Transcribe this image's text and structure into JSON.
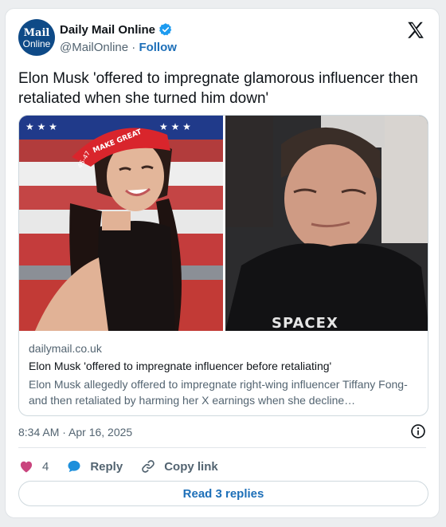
{
  "account": {
    "avatar_line1": "Mail",
    "avatar_line2": "Online",
    "name": "Daily Mail Online",
    "handle": "@MailOnline",
    "separator": "·",
    "follow_label": "Follow"
  },
  "tweet": {
    "text": "Elon Musk 'offered to impregnate glamorous influencer then retaliated when she turned him down'",
    "timestamp": "8:34 AM · Apr 16, 2025"
  },
  "link_card": {
    "domain": "dailymail.co.uk",
    "title": "Elon Musk 'offered to impregnate influencer before retaliating'",
    "description": "Elon Musk allegedly offered to impregnate right-wing influencer Tiffany Fong- and then retaliated by harming her X earnings when she decline…",
    "image_left_cap_text": "MAKE GREAT",
    "image_left_cap_number": "45-47",
    "image_right_shirt_text": "SPACEX"
  },
  "actions": {
    "like_count": "4",
    "reply_label": "Reply",
    "copy_label": "Copy link",
    "read_replies_label": "Read 3 replies"
  },
  "icons": {
    "verified": "verified-badge-icon",
    "x_logo": "x-logo-icon",
    "info": "info-icon",
    "heart": "heart-icon",
    "reply": "reply-bubble-icon",
    "copy": "link-icon"
  },
  "colors": {
    "accent": "#1d6fb8",
    "heart": "#c9457e",
    "reply_bubble": "#1d8fdb",
    "text_secondary": "#536471"
  }
}
